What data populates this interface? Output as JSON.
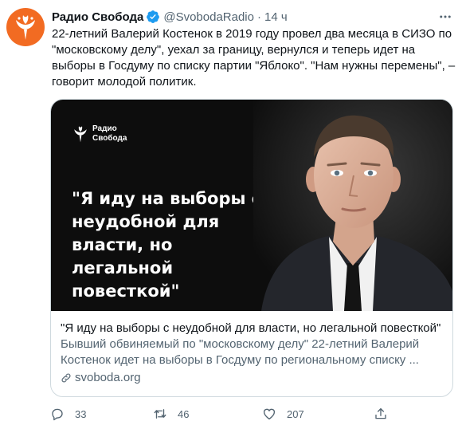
{
  "tweet": {
    "author_name": "Радио Свобода",
    "handle": "@SvobodaRadio",
    "separator": "·",
    "time": "14 ч",
    "text": "22-летний  Валерий Костенок  в 2019 году провел два месяца в СИЗО по \"московскому делу\", уехал за границу, вернулся и теперь идет на выборы в Госдуму по списку партии \"Яблоко\". \"Нам нужны перемены\", – говорит молодой политик."
  },
  "card": {
    "image_logo_text": "Радио\nСвобода",
    "image_quote": "\"Я иду на выборы с\nнеудобной для\nвласти, но легальной\nповесткой\"",
    "title": "\"Я иду на выборы с неудобной для власти, но легальной повесткой\"",
    "description": "Бывший обвиняемый по \"московскому делу\" 22-летний Валерий Костенок идет на выборы в Госдуму по региональному списку ...",
    "domain": "svoboda.org"
  },
  "actions": {
    "replies": "33",
    "retweets": "46",
    "likes": "207"
  },
  "colors": {
    "brand_orange": "#f26b22",
    "verified_blue": "#1d9bf0",
    "secondary_text": "#536471",
    "card_border": "#cfd9de"
  }
}
